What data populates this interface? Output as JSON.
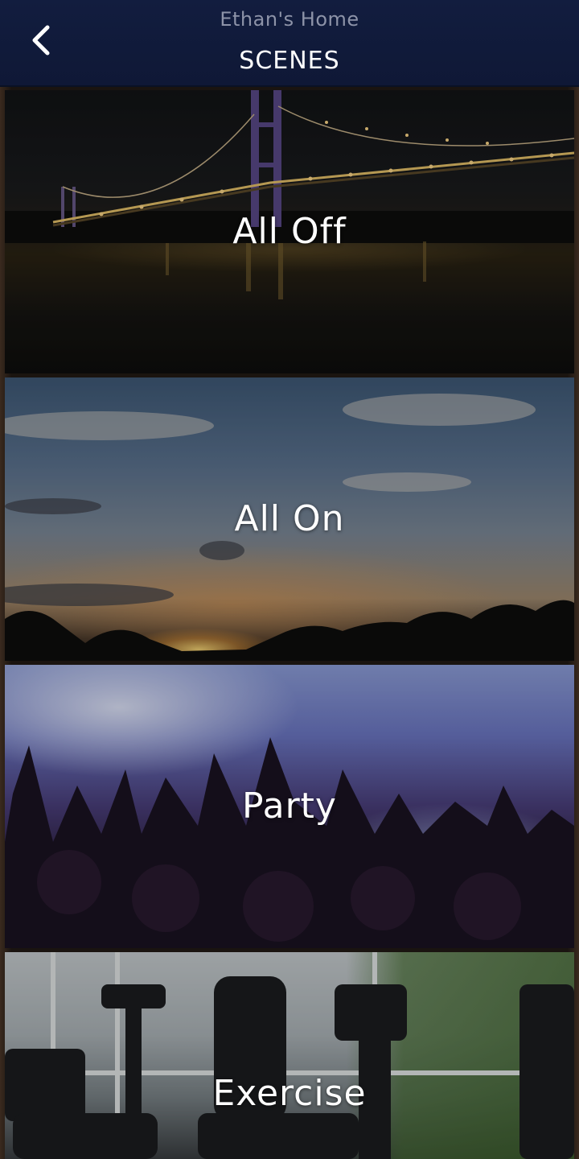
{
  "header": {
    "home_name": "Ethan's Home",
    "title": "SCENES",
    "back_icon": "chevron-left-icon"
  },
  "scenes": [
    {
      "label": "All Off"
    },
    {
      "label": "All On"
    },
    {
      "label": "Party"
    },
    {
      "label": "Exercise"
    }
  ],
  "colors": {
    "header_bg": "#121d3f",
    "title_text": "#ffffff",
    "subtitle_text": "#8d93a8"
  }
}
